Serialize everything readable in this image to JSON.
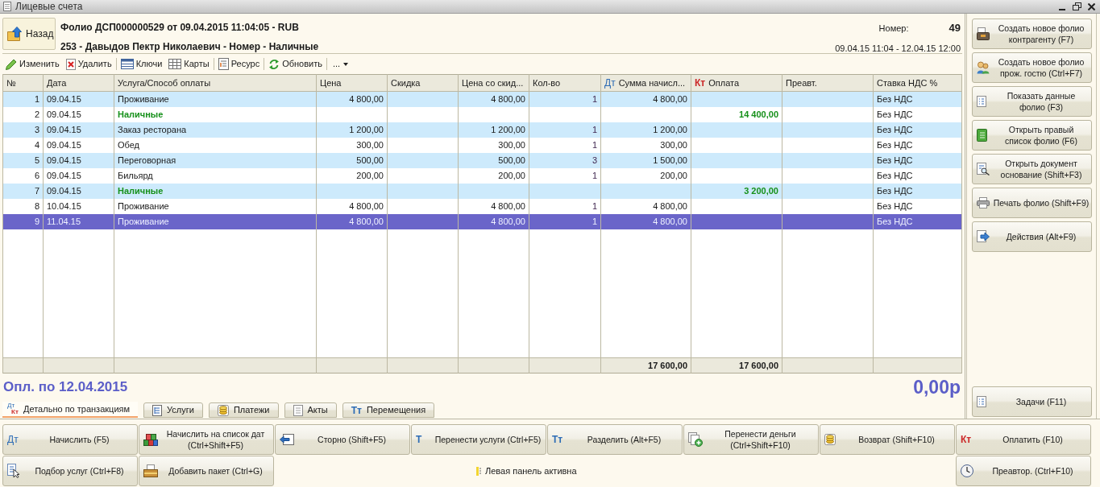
{
  "window": {
    "title": "Лицевые счета"
  },
  "header": {
    "back_button": "Назад",
    "folio_title": "Фолио ДСП000000529 от 09.04.2015 11:04:05 - RUB",
    "guest_line": "253 - Давыдов Пектр Николаевич - Номер - Наличные",
    "room_label": "Номер:",
    "room_number": "49",
    "period": "09.04.15 11:04 - 12.04.15 12:00"
  },
  "toolbar": [
    [
      {
        "label": "Изменить",
        "kind": "button"
      },
      {
        "label": "Удалить",
        "kind": "button"
      }
    ],
    [
      {
        "label": "Ключи",
        "kind": "button"
      },
      {
        "label": "Карты",
        "kind": "button"
      }
    ],
    [
      {
        "label": "Ресурс",
        "kind": "button"
      }
    ],
    [
      {
        "label": "Обновить",
        "kind": "button"
      }
    ],
    [
      {
        "label": "...",
        "kind": "menu"
      }
    ]
  ],
  "table": {
    "columns": [
      {
        "label": "№"
      },
      {
        "label": "Дата"
      },
      {
        "label": "Услуга/Способ оплаты"
      },
      {
        "label": "Цена"
      },
      {
        "label": "Скидка"
      },
      {
        "label": "Цена со скид..."
      },
      {
        "label": "Кол-во"
      },
      {
        "label": "Сумма начисл...",
        "glyph": {
          "text": "Дт",
          "kind": "debit"
        }
      },
      {
        "label": "Оплата",
        "glyph": {
          "text": "Кт",
          "kind": "credit"
        }
      },
      {
        "label": "Преавт."
      },
      {
        "label": "Ставка НДС %"
      }
    ],
    "rows": [
      {
        "kind": "service",
        "selected": false,
        "number": "1",
        "date": "09.04.15",
        "service": "Проживание",
        "price": "4 800,00",
        "discounted_price": "4 800,00",
        "quantity": "1",
        "amount": "4 800,00",
        "vat_rate": "Без НДС"
      },
      {
        "kind": "payment",
        "selected": false,
        "number": "2",
        "date": "09.04.15",
        "service": "Наличные",
        "payment": "14 400,00",
        "vat_rate": "Без НДС"
      },
      {
        "kind": "service",
        "selected": false,
        "number": "3",
        "date": "09.04.15",
        "service": "Заказ ресторана",
        "price": "1 200,00",
        "discounted_price": "1 200,00",
        "quantity": "1",
        "amount": "1 200,00",
        "vat_rate": "Без НДС"
      },
      {
        "kind": "service",
        "selected": false,
        "number": "4",
        "date": "09.04.15",
        "service": "Обед",
        "price": "300,00",
        "discounted_price": "300,00",
        "quantity": "1",
        "amount": "300,00",
        "vat_rate": "Без НДС"
      },
      {
        "kind": "service",
        "selected": false,
        "number": "5",
        "date": "09.04.15",
        "service": "Переговорная",
        "price": "500,00",
        "discounted_price": "500,00",
        "quantity": "3",
        "amount": "1 500,00",
        "vat_rate": "Без НДС"
      },
      {
        "kind": "service",
        "selected": false,
        "number": "6",
        "date": "09.04.15",
        "service": "Бильярд",
        "price": "200,00",
        "discounted_price": "200,00",
        "quantity": "1",
        "amount": "200,00",
        "vat_rate": "Без НДС"
      },
      {
        "kind": "payment",
        "selected": false,
        "number": "7",
        "date": "09.04.15",
        "service": "Наличные",
        "payment": "3 200,00",
        "vat_rate": "Без НДС"
      },
      {
        "kind": "service",
        "selected": false,
        "number": "8",
        "date": "10.04.15",
        "service": "Проживание",
        "price": "4 800,00",
        "discounted_price": "4 800,00",
        "quantity": "1",
        "amount": "4 800,00",
        "vat_rate": "Без НДС"
      },
      {
        "kind": "service",
        "selected": true,
        "number": "9",
        "date": "11.04.15",
        "service": "Проживание",
        "price": "4 800,00",
        "discounted_price": "4 800,00",
        "quantity": "1",
        "amount": "4 800,00",
        "vat_rate": "Без НДС"
      }
    ],
    "totals": {
      "amount": "17 600,00",
      "payment": "17 600,00"
    }
  },
  "balance": {
    "label": "Опл. по 12.04.2015",
    "amount": "0,00р"
  },
  "tabs": [
    {
      "label": "Детально по транзакциям",
      "selected": true,
      "glyphs": [
        {
          "text": "Дт",
          "kind": "debit"
        },
        {
          "text": "Кт",
          "kind": "credit"
        }
      ]
    },
    {
      "label": "Услуги",
      "selected": false
    },
    {
      "label": "Платежи",
      "selected": false
    },
    {
      "label": "Акты",
      "selected": false
    },
    {
      "label": "Перемещения",
      "selected": false,
      "glyphs": [
        {
          "text": "Тт",
          "kind": "transfer"
        }
      ]
    }
  ],
  "side_actions": [
    {
      "lines": [
        "Создать новое фолио",
        "контрагенту (F7)"
      ]
    },
    {
      "lines": [
        "Создать новое фолио",
        "прож. гостю (Ctrl+F7)"
      ]
    },
    {
      "lines": [
        "Показать данные",
        "фолио (F3)"
      ]
    },
    {
      "lines": [
        "Открыть правый",
        "список фолио (F6)"
      ]
    },
    {
      "lines": [
        "Открыть документ",
        "основание (Shift+F3)"
      ]
    },
    {
      "lines": [
        "Печать фолио (Shift+F9)"
      ]
    },
    {
      "lines": [
        "Действия (Alt+F9)"
      ]
    }
  ],
  "side_bottom": [
    {
      "lines": [
        "Задачи (F11)"
      ]
    }
  ],
  "actions": [
    {
      "lines": [
        "Начислить (F5)"
      ],
      "glyph": {
        "text": "Дт",
        "kind": "debit"
      }
    },
    {
      "lines": [
        "Начислить на список дат",
        "(Ctrl+Shift+F5)"
      ]
    },
    {
      "lines": [
        "Сторно (Shift+F5)"
      ]
    },
    {
      "lines": [
        "Перенести услуги (Ctrl+F5)"
      ],
      "glyph": {
        "text": "Т",
        "kind": "transfer"
      }
    },
    {
      "lines": [
        "Разделить (Alt+F5)"
      ],
      "glyph": {
        "text": "Тт",
        "kind": "transfer"
      }
    },
    {
      "lines": [
        "Перенести деньги",
        "(Ctrl+Shift+F10)"
      ]
    },
    {
      "lines": [
        "Возврат (Shift+F10)"
      ]
    },
    {
      "lines": [
        "Оплатить (F10)"
      ],
      "glyph": {
        "text": "Кт",
        "kind": "credit"
      }
    }
  ],
  "actions_left": [
    {
      "lines": [
        "Подбор услуг (Ctrl+F8)"
      ]
    },
    {
      "lines": [
        "Добавить пакет (Ctrl+G)"
      ]
    }
  ],
  "status": "Левая панель активна",
  "actions_right": [
    {
      "lines": [
        "Преавтор. (Ctrl+F10)"
      ]
    }
  ]
}
